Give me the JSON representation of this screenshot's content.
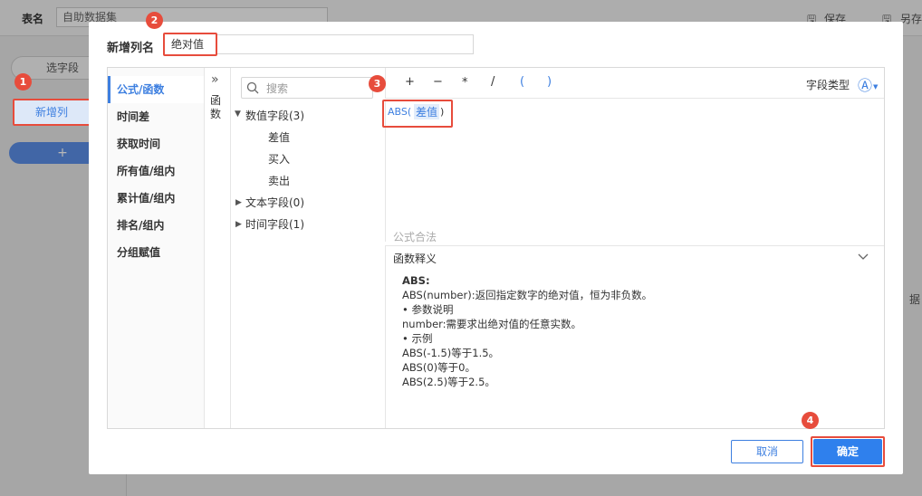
{
  "background": {
    "table_label": "表名",
    "table_name": "自助数据集",
    "save_label": "保存",
    "save_as_label": "另存",
    "select_field_label": "选字段",
    "new_column_label": "新增列",
    "add_symbol": "+",
    "right_partial": "据"
  },
  "dialog": {
    "name_label": "新增列名",
    "name_value": "绝对值",
    "categories": [
      "公式/函数",
      "时间差",
      "获取时间",
      "所有值/组内",
      "累计值/组内",
      "排名/组内",
      "分组赋值"
    ],
    "collapse_icon": "»",
    "function_tab_label": "函数",
    "search_placeholder": "搜索",
    "tree": {
      "numeric_group": "数值字段(3)",
      "numeric_items": [
        "差值",
        "买入",
        "卖出"
      ],
      "text_group": "文本字段(0)",
      "time_group": "时间字段(1)"
    },
    "operators": [
      "+",
      "−",
      "*",
      "/",
      "(",
      ")"
    ],
    "field_type_label": "字段类型",
    "field_type_icon": "Ⓐ",
    "formula_prefix": "ABS(",
    "formula_field": "差值",
    "formula_suffix": ")",
    "formula_status": "公式合法",
    "explain_title": "函数释义",
    "explain_lines": [
      "ABS:",
      "ABS(number):返回指定数字的绝对值，恒为非负数。",
      "• 参数说明",
      "number:需要求出绝对值的任意实数。",
      "• 示例",
      "ABS(-1.5)等于1.5。",
      "ABS(0)等于0。",
      "ABS(2.5)等于2.5。"
    ],
    "cancel_label": "取消",
    "ok_label": "确定"
  },
  "badges": [
    "1",
    "2",
    "3",
    "4"
  ],
  "colors": {
    "accent": "#3d7fe0",
    "annotation": "#e74c3c",
    "primary_button": "#2f80ed"
  }
}
